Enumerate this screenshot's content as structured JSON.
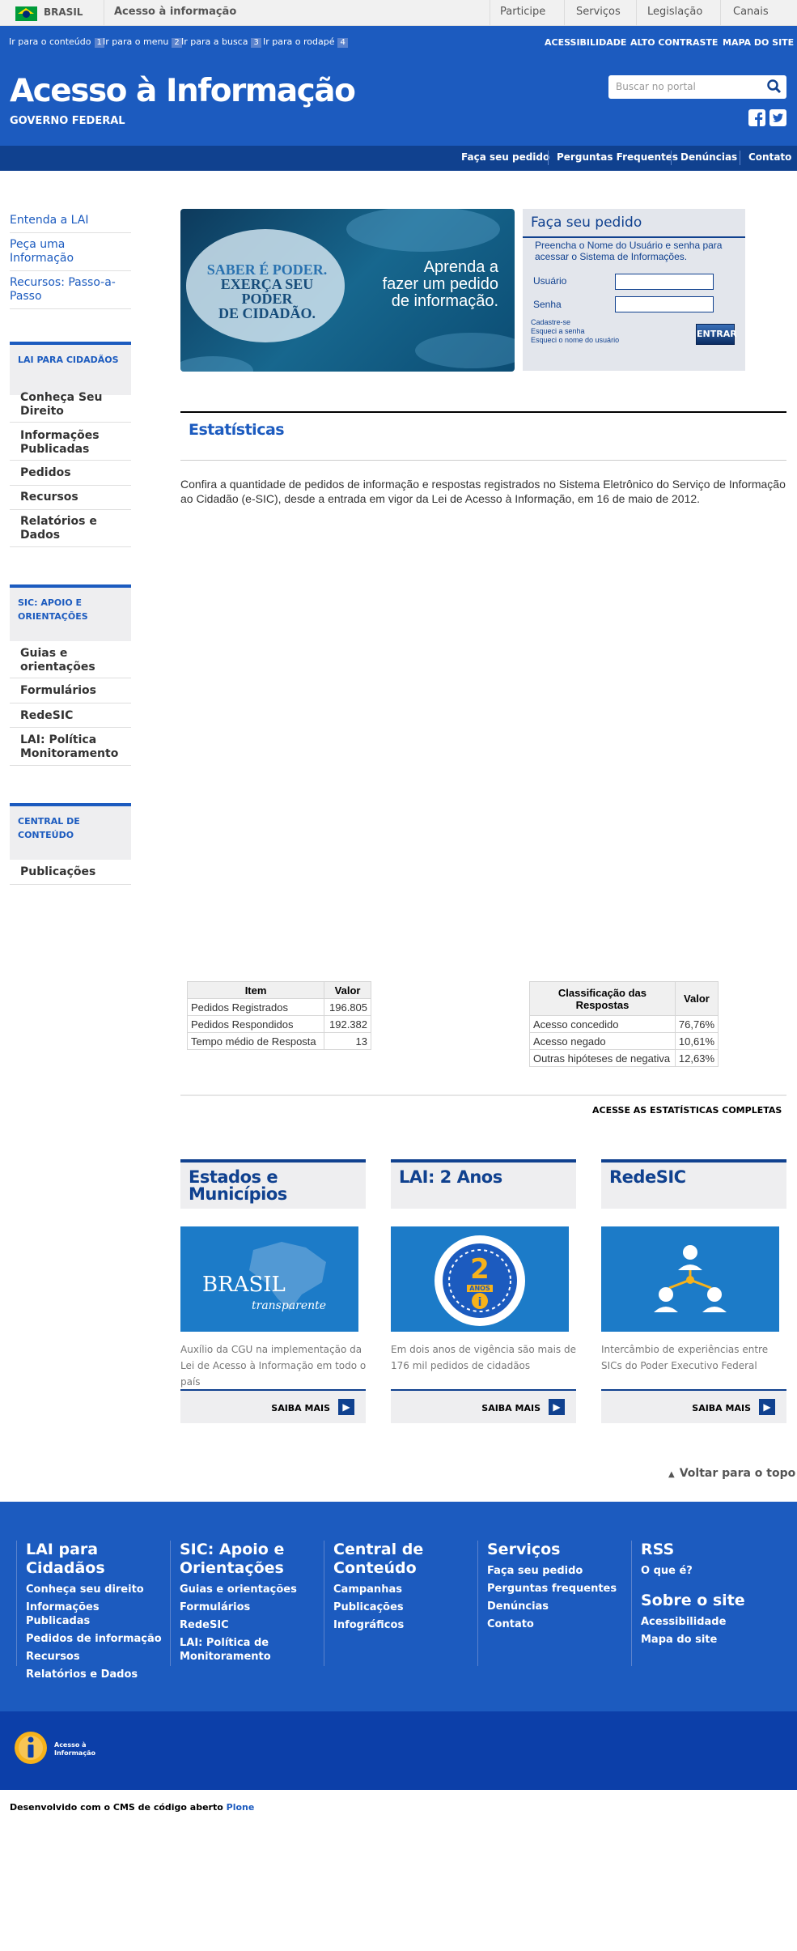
{
  "govbar": {
    "brasil": "BRASIL",
    "site": "Acesso à informação",
    "links": [
      "Participe",
      "Serviços",
      "Legislação",
      "Canais"
    ]
  },
  "skip": [
    {
      "label": "Ir para o conteúdo",
      "key": "1"
    },
    {
      "label": "Ir para o menu",
      "key": "2"
    },
    {
      "label": "Ir para a busca",
      "key": "3"
    },
    {
      "label": "Ir para o rodapé",
      "key": "4"
    }
  ],
  "toplinks": [
    "ACESSIBILIDADE",
    "ALTO CONTRASTE",
    "MAPA DO SITE"
  ],
  "header": {
    "title": "Acesso à Informação",
    "subtitle": "GOVERNO FEDERAL",
    "search_placeholder": "Buscar no portal"
  },
  "nav": [
    "Faça seu pedido",
    "Perguntas Frequentes",
    "Denúncias",
    "Contato"
  ],
  "sidebar": {
    "top": [
      "Entenda a LAI",
      "Peça uma Informação",
      "Recursos: Passo-a-Passo"
    ],
    "sections": [
      {
        "title": "LAI PARA CIDADÃOS",
        "items": [
          "Conheça Seu Direito",
          "Informações Publicadas",
          "Pedidos",
          "Recursos",
          "Relatórios e Dados"
        ]
      },
      {
        "title": "SIC: APOIO E ORIENTAÇÕES",
        "items": [
          "Guias e orientações",
          "Formulários",
          "RedeSIC",
          "LAI: Política Monitoramento"
        ]
      },
      {
        "title": "CENTRAL DE CONTEÚDO",
        "items": [
          "Publicações"
        ]
      }
    ]
  },
  "banner": {
    "left_line1": "SABER É PODER.",
    "left_line2": "EXERÇA SEU PODER",
    "left_line3": "DE CIDADÃO.",
    "right_line1": "Aprenda a",
    "right_line2": "fazer um pedido",
    "right_line3": "de informação."
  },
  "login": {
    "title": "Faça seu pedido",
    "intro": "Preencha o Nome do Usuário e senha para acessar o Sistema de Informações.",
    "user": "Usuário",
    "pass": "Senha",
    "links": [
      "Cadastre-se",
      "Esqueci a senha",
      "Esqueci o nome do usuário"
    ],
    "button": "ENTRAR"
  },
  "stats": {
    "title": "Estatísticas",
    "text": "Confira a quantidade de pedidos de informação e respostas registrados no Sistema Eletrônico do Serviço de Informação ao Cidadão (e-SIC), desde a entrada em vigor da Lei de Acesso à Informação, em 16 de maio de 2012.",
    "t1": {
      "headers": [
        "Item",
        "Valor"
      ],
      "rows": [
        [
          "Pedidos Registrados",
          "196.805"
        ],
        [
          "Pedidos Respondidos",
          "192.382"
        ],
        [
          "Tempo médio de Resposta",
          "13"
        ]
      ]
    },
    "t2": {
      "headers": [
        "Classificação das Respostas",
        "Valor"
      ],
      "rows": [
        [
          "Acesso concedido",
          "76,76%"
        ],
        [
          "Acesso negado",
          "10,61%"
        ],
        [
          "Outras hipóteses de negativa",
          "12,63%"
        ]
      ]
    },
    "more": "ACESSE AS ESTATÍSTICAS COMPLETAS"
  },
  "cards": [
    {
      "title": "Estados e Municípios",
      "img": "BRASIL",
      "img_sub": "transparente",
      "text": "Auxílio da CGU na implementação da Lei de Acesso à Informação em todo o país",
      "button": "SAIBA MAIS"
    },
    {
      "title": "LAI: 2 Anos",
      "img": "2",
      "img_sub": "ANOS",
      "text": "Em dois anos de vigência são mais de 176 mil pedidos de cidadãos",
      "button": "SAIBA MAIS"
    },
    {
      "title": "RedeSIC",
      "img": "",
      "img_sub": "",
      "text": "Intercâmbio de experiências entre SICs do Poder Executivo Federal",
      "button": "SAIBA MAIS"
    }
  ],
  "to_top": "Voltar para o topo",
  "footer": [
    {
      "title": "LAI para Cidadãos",
      "links": [
        "Conheça seu direito",
        "Informações Publicadas",
        "Pedidos de informação",
        "Recursos",
        "Relatórios e Dados"
      ]
    },
    {
      "title": "SIC: Apoio e Orientações",
      "links": [
        "Guias e orientações",
        "Formulários",
        "RedeSIC",
        "LAI: Política de Monitoramento"
      ]
    },
    {
      "title": "Central de Conteúdo",
      "links": [
        "Campanhas",
        "Publicações",
        "Infográficos"
      ]
    },
    {
      "title": "Serviços",
      "links": [
        "Faça seu pedido",
        "Perguntas frequentes",
        "Denúncias",
        "Contato"
      ]
    },
    {
      "title": "RSS",
      "links": [
        "O que é?"
      ],
      "title2": "Sobre o site",
      "links2": [
        "Acessibilidade",
        "Mapa do site"
      ]
    }
  ],
  "logo_text": "Acesso à Informação",
  "credits": {
    "prefix": "Desenvolvido com o CMS de código aberto",
    "link": "Plone"
  }
}
